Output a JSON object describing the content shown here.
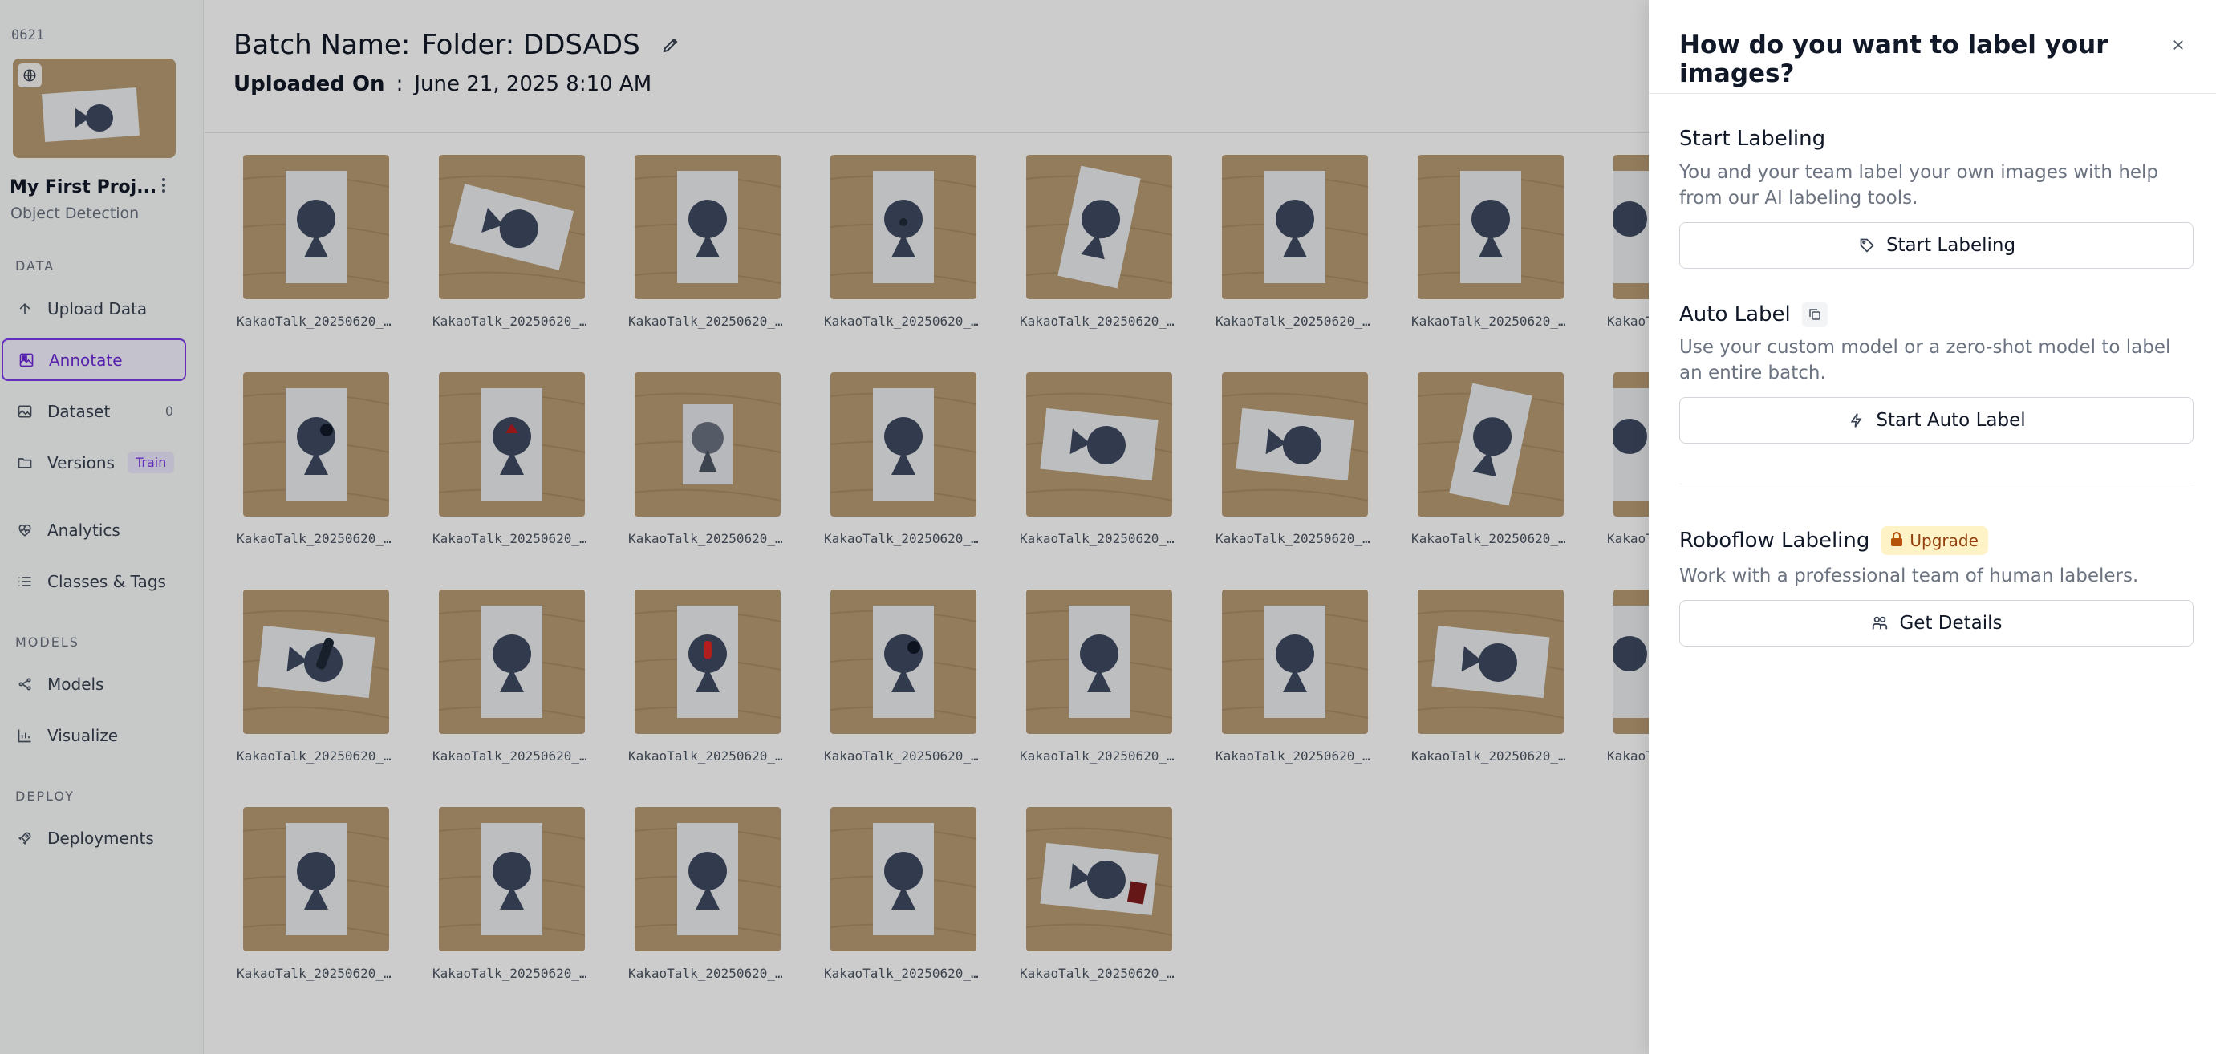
{
  "workspace": {
    "label": "0621"
  },
  "project": {
    "name": "My First Proj...",
    "type": "Object Detection"
  },
  "sidebar": {
    "sections": {
      "data": "DATA",
      "models": "MODELS",
      "deploy": "DEPLOY"
    },
    "items": [
      {
        "label": "Upload Data",
        "icon": "upload-arrow-icon"
      },
      {
        "label": "Annotate",
        "icon": "annotate-icon",
        "active": true
      },
      {
        "label": "Dataset",
        "icon": "image-icon",
        "badge": "0"
      },
      {
        "label": "Versions",
        "icon": "folder-icon",
        "pill": "Train"
      },
      {
        "label": "Analytics",
        "icon": "heart-pulse-icon"
      },
      {
        "label": "Classes & Tags",
        "icon": "list-icon"
      },
      {
        "label": "Models",
        "icon": "network-icon"
      },
      {
        "label": "Visualize",
        "icon": "bar-chart-icon"
      },
      {
        "label": "Deployments",
        "icon": "rocket-icon"
      }
    ]
  },
  "batch": {
    "name_label": "Batch Name:",
    "name_value": "Folder: DDSADS",
    "uploaded_label": "Uploaded On",
    "uploaded_sep": ":",
    "uploaded_value": "June 21, 2025 8:10 AM"
  },
  "images": {
    "caption": "KakaoTalk_20250620_...",
    "rows": [
      [
        "card-upright",
        "card-tilted-left",
        "card-upright",
        "card-dot",
        "card-tilted-right",
        "card-upright",
        "card-upright",
        "card-partial"
      ],
      [
        "card-dark-dot",
        "card-red-arrow",
        "card-grey",
        "card-upright",
        "card-sideways",
        "card-sideways",
        "card-tilted-right",
        "card-partial"
      ],
      [
        "card-sideways-dark",
        "card-upright",
        "card-red-top",
        "card-dark-dot",
        "card-upright",
        "card-upright",
        "card-sideways",
        "card-partial"
      ],
      [
        "card-upright",
        "card-upright",
        "card-upright",
        "card-upright",
        "card-sideways-red"
      ]
    ]
  },
  "drawer": {
    "title": "How do you want to label your images?",
    "start": {
      "title": "Start Labeling",
      "desc": "You and your team label your own images with help from our AI labeling tools.",
      "button": "Start Labeling"
    },
    "auto": {
      "title": "Auto Label",
      "desc": "Use your custom model or a zero-shot model to label an entire batch.",
      "button": "Start Auto Label"
    },
    "roboflow": {
      "title": "Roboflow Labeling",
      "badge": "Upgrade",
      "desc": "Work with a professional team of human labelers.",
      "button": "Get Details"
    }
  },
  "colors": {
    "accent": "#7c3aed",
    "upgrade_bg": "#fef3c7",
    "upgrade_fg": "#92400e"
  }
}
